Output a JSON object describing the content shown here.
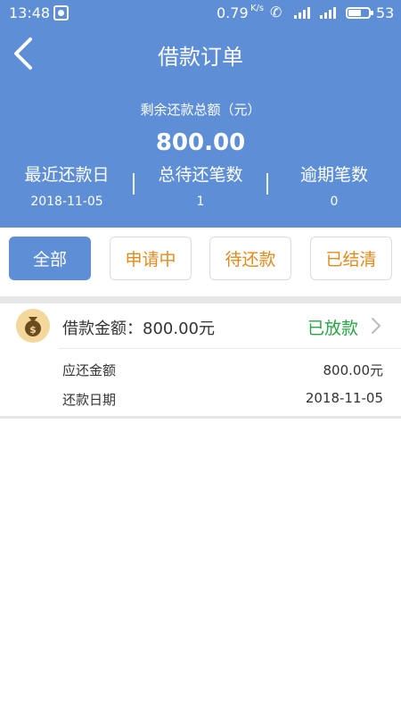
{
  "status_bar": {
    "time": "13:48",
    "speed": "0.79",
    "speed_unit": "K/s",
    "battery": "53"
  },
  "header": {
    "title": "借款订单",
    "summary_label": "剩余还款总额（元）",
    "summary_amount": "800.00",
    "stats": [
      {
        "label": "最近还款日",
        "value": "2018-11-05"
      },
      {
        "label": "总待还笔数",
        "value": "1"
      },
      {
        "label": "逾期笔数",
        "value": "0"
      }
    ]
  },
  "tabs": [
    {
      "label": "全部",
      "active": true
    },
    {
      "label": "申请中",
      "active": false
    },
    {
      "label": "待还款",
      "active": false
    },
    {
      "label": "已结清",
      "active": false
    }
  ],
  "orders": [
    {
      "title": "借款金额：800.00元",
      "status": "已放款",
      "rows": [
        {
          "label": "应还金额",
          "value": "800.00元"
        },
        {
          "label": "还款日期",
          "value": "2018-11-05"
        }
      ]
    }
  ],
  "colors": {
    "primary": "#5e8fd6",
    "tab_inactive_text": "#e38a1d",
    "status_green": "#2aa546"
  },
  "icons": [
    "back-arrow-icon",
    "money-bag-icon",
    "chevron-right-icon",
    "phone-icon",
    "signal-icon",
    "battery-icon",
    "notification-icon"
  ]
}
